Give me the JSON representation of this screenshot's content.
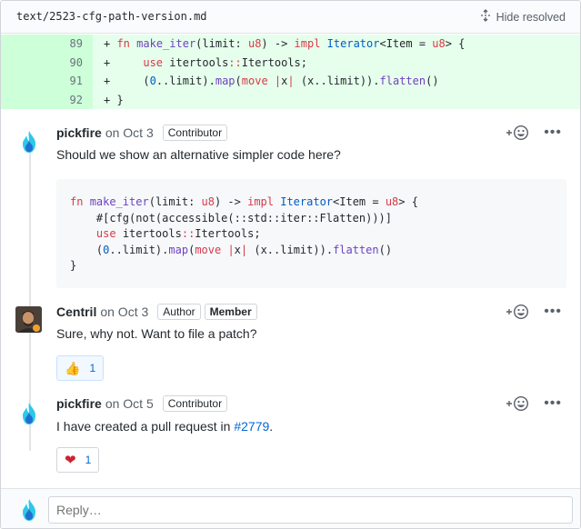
{
  "file": {
    "path": "text/2523-cfg-path-version.md",
    "hide_resolved_label": "Hide resolved"
  },
  "diff": [
    {
      "line": "89",
      "tokens": [
        [
          "p",
          "+ "
        ],
        [
          "k",
          "fn "
        ],
        [
          "f",
          "make_iter"
        ],
        [
          "p",
          "(limit: "
        ],
        [
          "k",
          "u8"
        ],
        [
          "p",
          ") -> "
        ],
        [
          "k",
          "impl "
        ],
        [
          "t",
          "Iterator"
        ],
        [
          "p",
          "<Item = "
        ],
        [
          "k",
          "u8"
        ],
        [
          "p",
          "> {"
        ]
      ]
    },
    {
      "line": "90",
      "tokens": [
        [
          "p",
          "+     "
        ],
        [
          "k",
          "use "
        ],
        [
          "p",
          "itertools"
        ],
        [
          "k",
          "::"
        ],
        [
          "p",
          "Itertools;"
        ]
      ]
    },
    {
      "line": "91",
      "tokens": [
        [
          "p",
          "+     ("
        ],
        [
          "t",
          "0"
        ],
        [
          "p",
          "..limit)."
        ],
        [
          "f",
          "map"
        ],
        [
          "p",
          "("
        ],
        [
          "k",
          "move "
        ],
        [
          "k",
          "|"
        ],
        [
          "p",
          "x"
        ],
        [
          "k",
          "| "
        ],
        [
          "p",
          "(x..limit))."
        ],
        [
          "f",
          "flatten"
        ],
        [
          "p",
          "()"
        ]
      ]
    },
    {
      "line": "92",
      "tokens": [
        [
          "p",
          "+ }"
        ]
      ]
    }
  ],
  "comments": [
    {
      "author": "pickfire",
      "date": "on Oct 3",
      "badges": [
        "Contributor"
      ],
      "text": "Should we show an alternative simpler code here?"
    },
    {
      "author": "Centril",
      "date": "on Oct 3",
      "badges": [
        "Author",
        "Member"
      ],
      "text": "Sure, why not. Want to file a patch?",
      "reaction": {
        "emoji": "👍",
        "count": "1"
      }
    },
    {
      "author": "pickfire",
      "date": "on Oct 5",
      "badges": [
        "Contributor"
      ],
      "text_prefix": "I have created a pull request in ",
      "link": "#2779",
      "text_suffix": ".",
      "reaction": {
        "emoji": "❤",
        "count": "1"
      }
    }
  ],
  "snippet": [
    [
      [
        "k",
        "fn "
      ],
      [
        "f",
        "make_iter"
      ],
      [
        "p",
        "(limit: "
      ],
      [
        "k",
        "u8"
      ],
      [
        "p",
        ") -> "
      ],
      [
        "k",
        "impl "
      ],
      [
        "t",
        "Iterator"
      ],
      [
        "p",
        "<Item = "
      ],
      [
        "k",
        "u8"
      ],
      [
        "p",
        "> {"
      ]
    ],
    [
      [
        "p",
        "    #[cfg(not(accessible(::std::iter::Flatten)))]"
      ]
    ],
    [
      [
        "p",
        "    "
      ],
      [
        "k",
        "use "
      ],
      [
        "p",
        "itertools"
      ],
      [
        "k",
        "::"
      ],
      [
        "p",
        "Itertools;"
      ]
    ],
    [
      [
        "p",
        "    ("
      ],
      [
        "t",
        "0"
      ],
      [
        "p",
        "..limit)."
      ],
      [
        "f",
        "map"
      ],
      [
        "p",
        "("
      ],
      [
        "k",
        "move "
      ],
      [
        "k",
        "|"
      ],
      [
        "p",
        "x"
      ],
      [
        "k",
        "| "
      ],
      [
        "p",
        "(x..limit))."
      ],
      [
        "f",
        "flatten"
      ],
      [
        "p",
        "()"
      ]
    ],
    [
      [
        "p",
        "}"
      ]
    ]
  ],
  "reply": {
    "placeholder": "Reply…"
  },
  "icons": {
    "hide": "unfold-icon",
    "add_reaction": "smiley-plus-icon",
    "more": "kebab-horizontal-icon",
    "avatar_pickfire": "flame-avatar-icon"
  },
  "colors": {
    "keyword": "#d73a49",
    "function": "#6f42c1",
    "type": "#005cc5",
    "link": "#0366d6",
    "diff_add_bg": "#e6ffec",
    "diff_add_num_bg": "#cdffd8",
    "flame": "#2dc8e8"
  }
}
